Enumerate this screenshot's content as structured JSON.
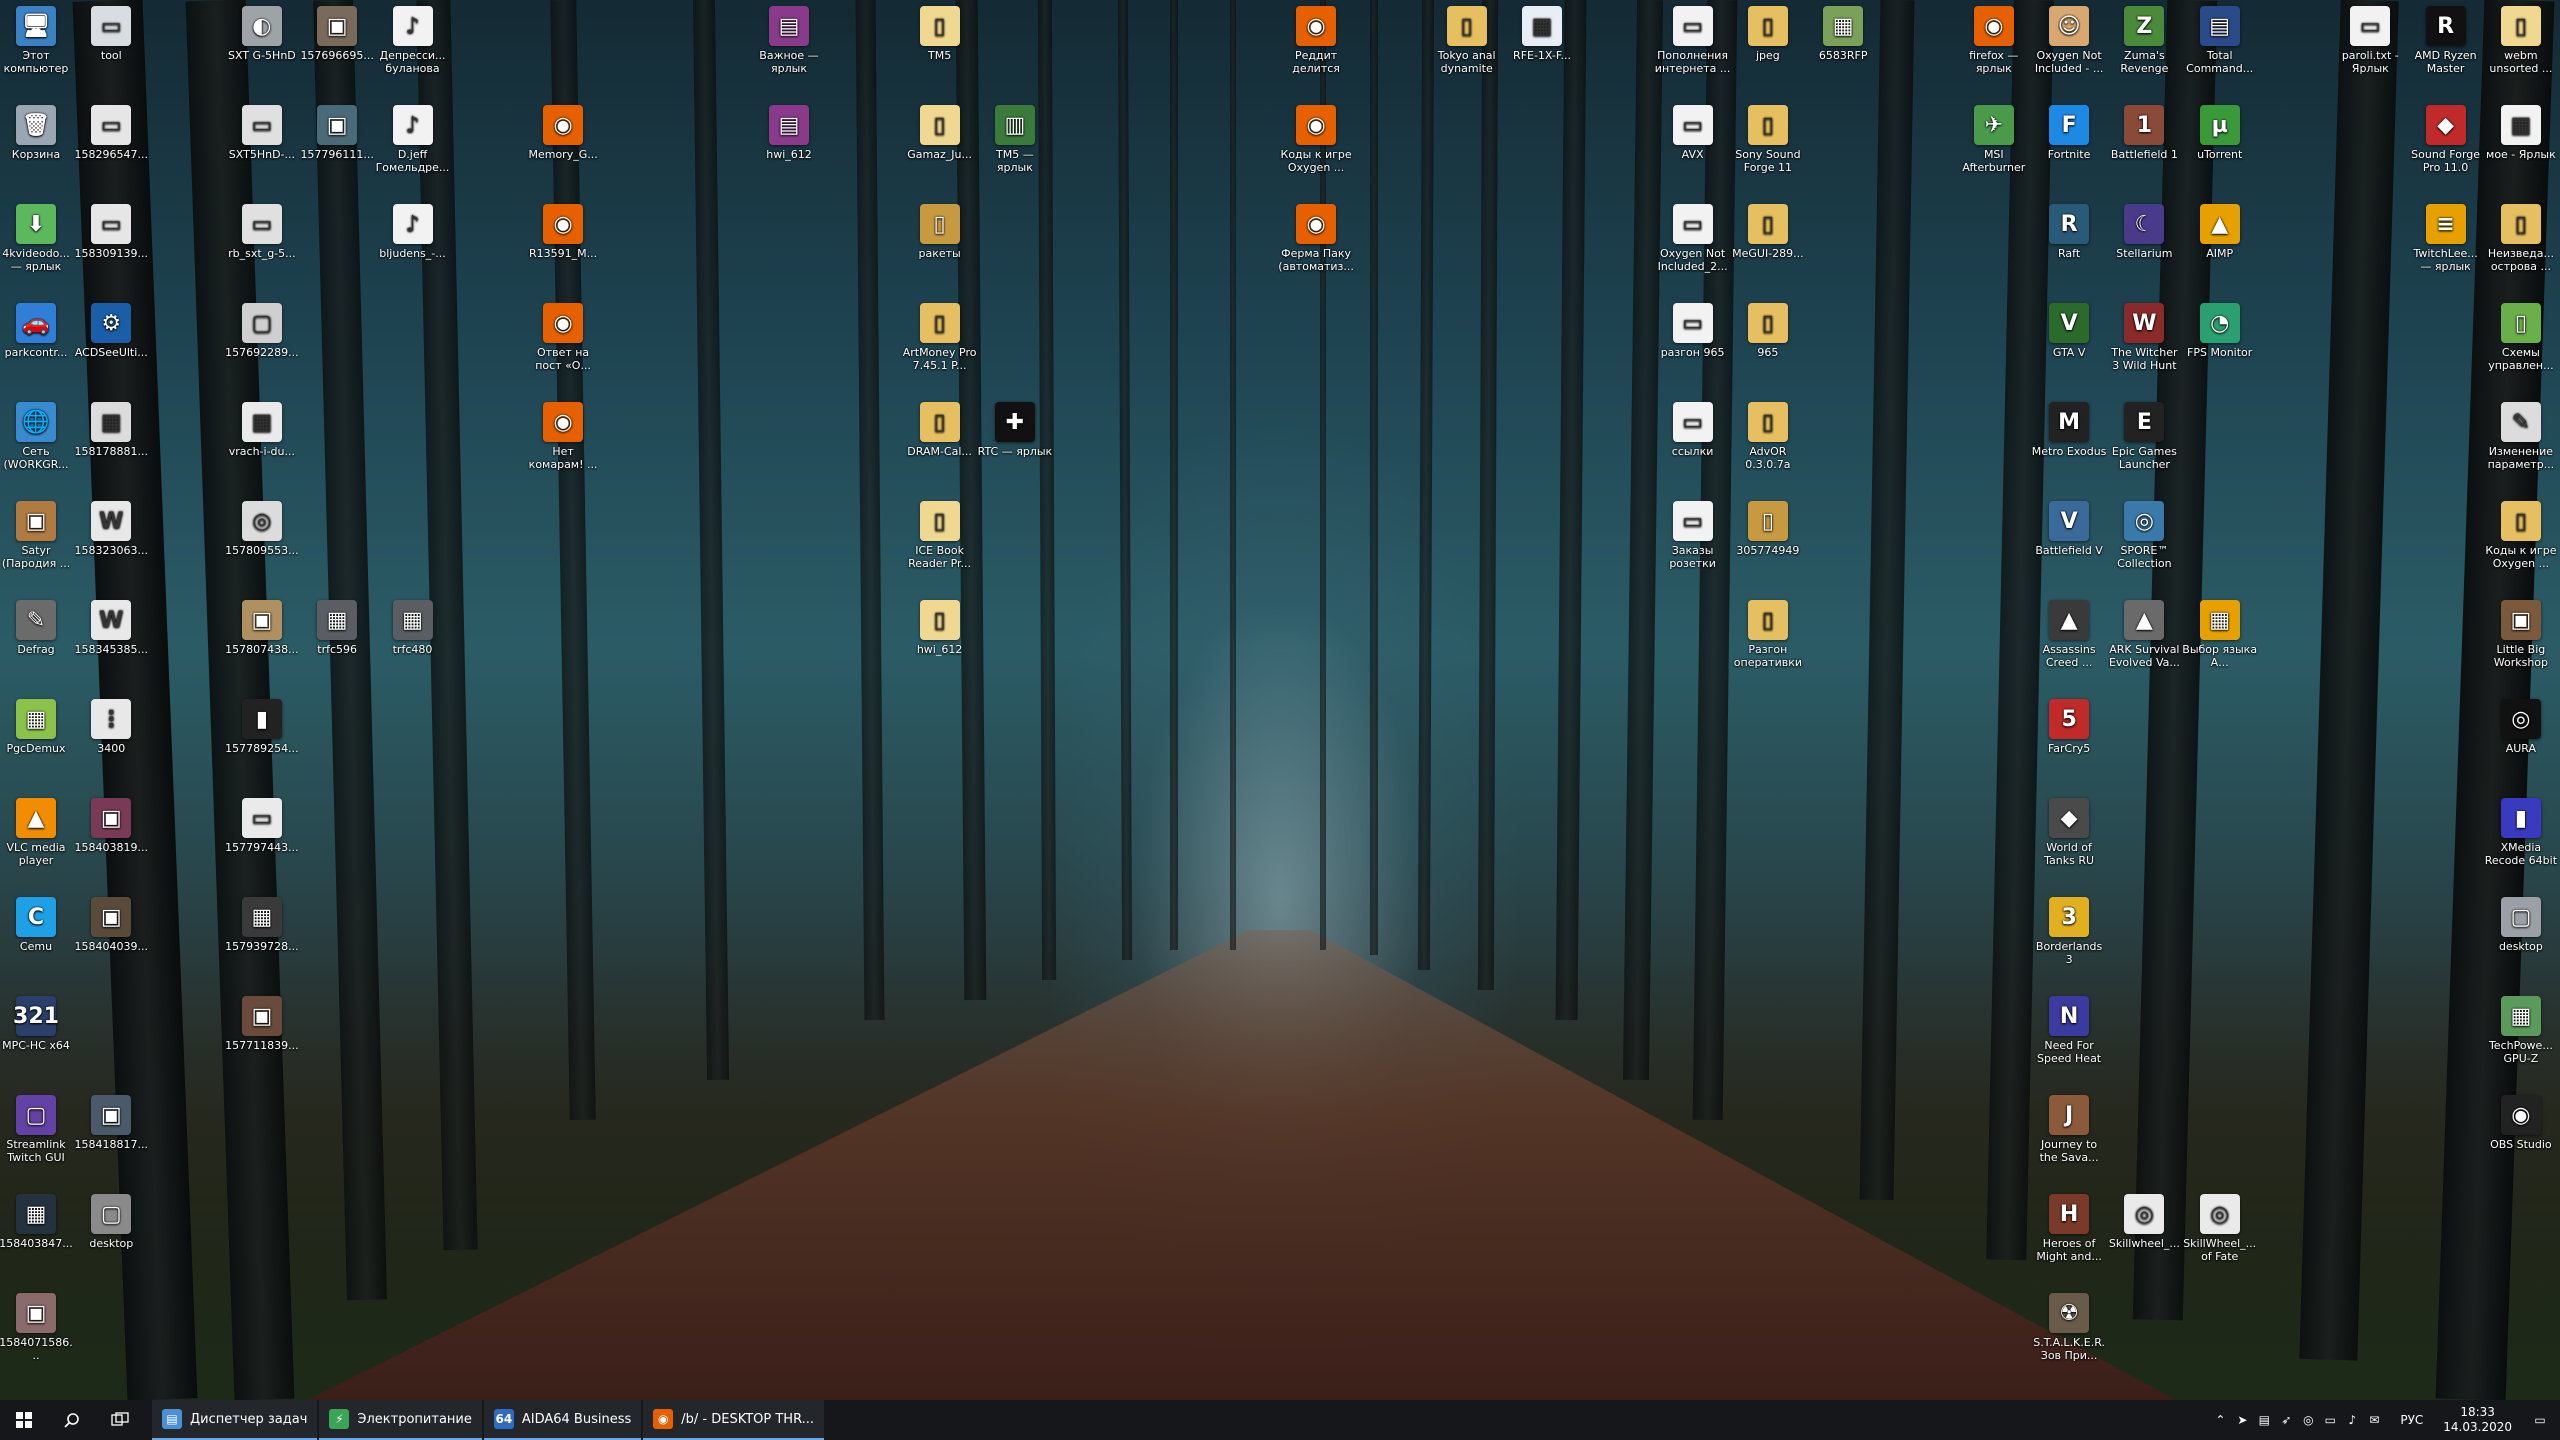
{
  "taskbar": {
    "start_icon": "windows-logo-icon",
    "search_icon": "search-icon",
    "taskview_icon": "task-view-icon",
    "apps": [
      {
        "label": "Диспетчер задач",
        "color": "#4a90d9",
        "glyph": "▤"
      },
      {
        "label": "Электропитание",
        "color": "#3aa655",
        "glyph": "⚡"
      },
      {
        "label": "AIDA64 Business",
        "color": "#2d6cc0",
        "glyph": "64"
      },
      {
        "label": "/b/ - DESKTOP THR...",
        "color": "#e66000",
        "glyph": "◉"
      }
    ],
    "tray": {
      "language": "РУС",
      "time": "18:33",
      "date": "14.03.2020",
      "icons": [
        "chevron-up-icon",
        "telegram-icon",
        "network-drive-icon",
        "cursor-icon",
        "steam-icon",
        "display-icon",
        "volume-icon",
        "notification-icon"
      ]
    }
  },
  "icons": [
    {
      "label": "Этот компьютер",
      "color": "#3b82c4",
      "glyph": "🖥",
      "col": 0,
      "row": 0
    },
    {
      "label": "Корзина",
      "color": "#9aa7b3",
      "glyph": "🗑",
      "col": 0,
      "row": 1
    },
    {
      "label": "4kvideodo... — ярлык",
      "color": "#5cb85c",
      "glyph": "⬇",
      "col": 0,
      "row": 2
    },
    {
      "label": "parkcontr...",
      "color": "#2f7fd8",
      "glyph": "🚗",
      "col": 0,
      "row": 3
    },
    {
      "label": "Сеть (WORKGR...",
      "color": "#3a8ad0",
      "glyph": "🌐",
      "col": 0,
      "row": 4
    },
    {
      "label": "Satyr (Пародия ...",
      "color": "#b07a40",
      "glyph": "▣",
      "col": 0,
      "row": 5
    },
    {
      "label": "Defrag",
      "color": "#6b6b6b",
      "glyph": "✎",
      "col": 0,
      "row": 6
    },
    {
      "label": "PgcDemux",
      "color": "#8bc34a",
      "glyph": "▦",
      "col": 0,
      "row": 7
    },
    {
      "label": "VLC media player",
      "color": "#f28c00",
      "glyph": "▲",
      "col": 0,
      "row": 8
    },
    {
      "label": "Cemu",
      "color": "#1ea0e6",
      "glyph": "C",
      "col": 0,
      "row": 9
    },
    {
      "label": "MPC-HC x64",
      "color": "#2a3f6a",
      "glyph": "321",
      "col": 0,
      "row": 10
    },
    {
      "label": "Streamlink Twitch GUI",
      "color": "#6441a5",
      "glyph": "▢",
      "col": 0,
      "row": 11
    },
    {
      "label": "158403847...",
      "color": "#24323f",
      "glyph": "▦",
      "col": 0,
      "row": 12
    },
    {
      "label": "1584071586...",
      "color": "#8a6a6a",
      "glyph": "▣",
      "col": 0,
      "row": 13
    },
    {
      "label": "tool",
      "color": "#d8dde2",
      "glyph": "▭",
      "col": 1,
      "row": 0
    },
    {
      "label": "158296547...",
      "color": "#e6e6e6",
      "glyph": "▭",
      "col": 1,
      "row": 1
    },
    {
      "label": "158309139...",
      "color": "#e6e6e6",
      "glyph": "▭",
      "col": 1,
      "row": 2
    },
    {
      "label": "ACDSeeUlti...",
      "color": "#1b5ea8",
      "glyph": "⚙",
      "col": 1,
      "row": 3
    },
    {
      "label": "158178881...",
      "color": "#dcdcdc",
      "glyph": "▦",
      "col": 1,
      "row": 4
    },
    {
      "label": "158323063...",
      "color": "#e8e8e8",
      "glyph": "W",
      "col": 1,
      "row": 5
    },
    {
      "label": "158345385...",
      "color": "#e8e8e8",
      "glyph": "W",
      "col": 1,
      "row": 6
    },
    {
      "label": "3400",
      "color": "#e8e8e8",
      "glyph": "⋮",
      "col": 1,
      "row": 7
    },
    {
      "label": "158403819...",
      "color": "#7a3a55",
      "glyph": "▣",
      "col": 1,
      "row": 8
    },
    {
      "label": "158404039...",
      "color": "#5a4a3a",
      "glyph": "▣",
      "col": 1,
      "row": 9
    },
    {
      "label": "158418817...",
      "color": "#4a5a6a",
      "glyph": "▣",
      "col": 1,
      "row": 11
    },
    {
      "label": "desktop",
      "color": "#8a8a8a",
      "glyph": "▢",
      "col": 1,
      "row": 12
    },
    {
      "label": "SXT G-5HnD",
      "color": "#9ea3a8",
      "glyph": "◐",
      "col": 3,
      "row": 0
    },
    {
      "label": "SXT5HnD-...",
      "color": "#e0e0e0",
      "glyph": "▭",
      "col": 3,
      "row": 1
    },
    {
      "label": "rb_sxt_g-5...",
      "color": "#e0e0e0",
      "glyph": "▭",
      "col": 3,
      "row": 2
    },
    {
      "label": "157692289...",
      "color": "#cfcfcf",
      "glyph": "▢",
      "col": 3,
      "row": 3
    },
    {
      "label": "vrach-i-du...",
      "color": "#eaeaea",
      "glyph": "▦",
      "col": 3,
      "row": 4
    },
    {
      "label": "157809553...",
      "color": "#dcdcdc",
      "glyph": "◎",
      "col": 3,
      "row": 5
    },
    {
      "label": "157807438...",
      "color": "#b09060",
      "glyph": "▣",
      "col": 3,
      "row": 6
    },
    {
      "label": "157789254...",
      "color": "#222",
      "glyph": "▮",
      "col": 3,
      "row": 7
    },
    {
      "label": "157797443...",
      "color": "#eaeaea",
      "glyph": "▭",
      "col": 3,
      "row": 8
    },
    {
      "label": "157939728...",
      "color": "#3a3a3a",
      "glyph": "▦",
      "col": 3,
      "row": 9
    },
    {
      "label": "157711839...",
      "color": "#6a4a3a",
      "glyph": "▣",
      "col": 3,
      "row": 10
    },
    {
      "label": "157696695...",
      "color": "#7a6a5a",
      "glyph": "▣",
      "col": 4,
      "row": 0
    },
    {
      "label": "157796111...",
      "color": "#4a6a7a",
      "glyph": "▣",
      "col": 4,
      "row": 1
    },
    {
      "label": "trfc596",
      "color": "#5a5e62",
      "glyph": "▦",
      "col": 4,
      "row": 6
    },
    {
      "label": "Депресси... буланова",
      "color": "#f2f2f2",
      "glyph": "♪",
      "col": 5,
      "row": 0
    },
    {
      "label": "D.jeff Гомельдре...",
      "color": "#f2f2f2",
      "glyph": "♪",
      "col": 5,
      "row": 1
    },
    {
      "label": "bljudens_-...",
      "color": "#f2f2f2",
      "glyph": "♪",
      "col": 5,
      "row": 2
    },
    {
      "label": "trfc480",
      "color": "#5a5e62",
      "glyph": "▦",
      "col": 5,
      "row": 6
    },
    {
      "label": "Memory_G...",
      "color": "#e66000",
      "glyph": "◉",
      "col": 7,
      "row": 1
    },
    {
      "label": "R13591_M...",
      "color": "#e66000",
      "glyph": "◉",
      "col": 7,
      "row": 2
    },
    {
      "label": "Ответ на пост «О...",
      "color": "#e66000",
      "glyph": "◉",
      "col": 7,
      "row": 3
    },
    {
      "label": "Нет комарам! ...",
      "color": "#e66000",
      "glyph": "◉",
      "col": 7,
      "row": 4
    },
    {
      "label": "Важное — ярлык",
      "color": "#8a3a8a",
      "glyph": "▤",
      "col": 10,
      "row": 0
    },
    {
      "label": "hwi_612",
      "color": "#8a3a8a",
      "glyph": "▤",
      "col": 10,
      "row": 1
    },
    {
      "label": "TM5",
      "color": "#f0d890",
      "glyph": "▯",
      "col": 12,
      "row": 0
    },
    {
      "label": "Gamaz_Ju...",
      "color": "#f0d890",
      "glyph": "▯",
      "col": 12,
      "row": 1
    },
    {
      "label": "ракеты",
      "color": "#c89a40",
      "glyph": "▯",
      "col": 12,
      "row": 2
    },
    {
      "label": "ArtMoney Pro 7.45.1 P...",
      "color": "#e6c060",
      "glyph": "▯",
      "col": 12,
      "row": 3
    },
    {
      "label": "DRAM-Cal...",
      "color": "#e6c060",
      "glyph": "▯",
      "col": 12,
      "row": 4
    },
    {
      "label": "ICE Book Reader Pr...",
      "color": "#f0d890",
      "glyph": "▯",
      "col": 12,
      "row": 5
    },
    {
      "label": "hwi_612",
      "color": "#f0d890",
      "glyph": "▯",
      "col": 12,
      "row": 6
    },
    {
      "label": "TM5 — ярлык",
      "color": "#3a7a3a",
      "glyph": "▥",
      "col": 13,
      "row": 1
    },
    {
      "label": "RTC — ярлык",
      "color": "#111",
      "glyph": "✚",
      "col": 13,
      "row": 4
    },
    {
      "label": "Реддит делится эф...",
      "color": "#e66000",
      "glyph": "◉",
      "col": 17,
      "row": 0
    },
    {
      "label": "Коды к игре Oxygen ...",
      "color": "#e66000",
      "glyph": "◉",
      "col": 17,
      "row": 1
    },
    {
      "label": "Ферма Паку (автоматиз...",
      "color": "#e66000",
      "glyph": "◉",
      "col": 17,
      "row": 2
    },
    {
      "label": "Tokyo anal dynamite",
      "color": "#e6c060",
      "glyph": "▯",
      "col": 19,
      "row": 0
    },
    {
      "label": "RFE-1X-F...",
      "color": "#e8eef5",
      "glyph": "▦",
      "col": 20,
      "row": 0
    },
    {
      "label": "Пополнения интернета ...",
      "color": "#f2f2f2",
      "glyph": "▭",
      "col": 22,
      "row": 0
    },
    {
      "label": "AVX",
      "color": "#f2f2f2",
      "glyph": "▭",
      "col": 22,
      "row": 1
    },
    {
      "label": "Oxygen Not Included_2...",
      "color": "#f2f2f2",
      "glyph": "▭",
      "col": 22,
      "row": 2
    },
    {
      "label": "разгон 965",
      "color": "#f2f2f2",
      "glyph": "▭",
      "col": 22,
      "row": 3
    },
    {
      "label": "ссылки",
      "color": "#f2f2f2",
      "glyph": "▭",
      "col": 22,
      "row": 4
    },
    {
      "label": "Заказы розетки",
      "color": "#f2f2f2",
      "glyph": "▭",
      "col": 22,
      "row": 5
    },
    {
      "label": "jpeg",
      "color": "#e6c060",
      "glyph": "▯",
      "col": 23,
      "row": 0
    },
    {
      "label": "Sony Sound Forge 11",
      "color": "#e6c060",
      "glyph": "▯",
      "col": 23,
      "row": 1
    },
    {
      "label": "MeGUI-289...",
      "color": "#e6c060",
      "glyph": "▯",
      "col": 23,
      "row": 2
    },
    {
      "label": "965",
      "color": "#e6c060",
      "glyph": "▯",
      "col": 23,
      "row": 3
    },
    {
      "label": "AdvOR 0.3.0.7a",
      "color": "#e6c060",
      "glyph": "▯",
      "col": 23,
      "row": 4
    },
    {
      "label": "305774949",
      "color": "#c89a40",
      "glyph": "▯",
      "col": 23,
      "row": 5
    },
    {
      "label": "Разгон оперативки",
      "color": "#e6c060",
      "glyph": "▯",
      "col": 23,
      "row": 6
    },
    {
      "label": "6583RFP",
      "color": "#7aa05a",
      "glyph": "▦",
      "col": 24,
      "row": 0
    },
    {
      "label": "firefox — ярлык",
      "color": "#e66000",
      "glyph": "◉",
      "col": 26,
      "row": 0
    },
    {
      "label": "MSI Afterburner",
      "color": "#4a9a4a",
      "glyph": "✈",
      "col": 26,
      "row": 1
    },
    {
      "label": "Oxygen Not Included - ...",
      "color": "#d8a870",
      "glyph": "☺",
      "col": 27,
      "row": 0
    },
    {
      "label": "Fortnite",
      "color": "#1e88e5",
      "glyph": "F",
      "col": 27,
      "row": 1
    },
    {
      "label": "Raft",
      "color": "#2a5a7a",
      "glyph": "R",
      "col": 27,
      "row": 2
    },
    {
      "label": "GTA V",
      "color": "#2a6a2a",
      "glyph": "V",
      "col": 27,
      "row": 3
    },
    {
      "label": "Metro Exodus",
      "color": "#222",
      "glyph": "M",
      "col": 27,
      "row": 4
    },
    {
      "label": "Battlefield V",
      "color": "#3a6a9a",
      "glyph": "V",
      "col": 27,
      "row": 5
    },
    {
      "label": "Assassins Creed ...",
      "color": "#3a3a3a",
      "glyph": "▲",
      "col": 27,
      "row": 6
    },
    {
      "label": "FarCry5",
      "color": "#c02a2a",
      "glyph": "5",
      "col": 27,
      "row": 7
    },
    {
      "label": "World of Tanks RU",
      "color": "#4a4a4a",
      "glyph": "◆",
      "col": 27,
      "row": 8
    },
    {
      "label": "Borderlands 3",
      "color": "#e0b020",
      "glyph": "3",
      "col": 27,
      "row": 9
    },
    {
      "label": "Need For Speed Heat",
      "color": "#3a3aa0",
      "glyph": "N",
      "col": 27,
      "row": 10
    },
    {
      "label": "Journey to the Sava...",
      "color": "#8a5a3a",
      "glyph": "J",
      "col": 27,
      "row": 11
    },
    {
      "label": "Heroes of Might and...",
      "color": "#7a3a2a",
      "glyph": "H",
      "col": 27,
      "row": 12
    },
    {
      "label": "S.T.A.L.K.E.R. Зов При...",
      "color": "#6a5a4a",
      "glyph": "☢",
      "col": 27,
      "row": 13
    },
    {
      "label": "Zuma's Revenge",
      "color": "#4a8a3a",
      "glyph": "Z",
      "col": 28,
      "row": 0
    },
    {
      "label": "Battlefield 1",
      "color": "#8a4a3a",
      "glyph": "1",
      "col": 28,
      "row": 1
    },
    {
      "label": "Stellarium",
      "color": "#4a3a8a",
      "glyph": "☾",
      "col": 28,
      "row": 2
    },
    {
      "label": "The Witcher 3 Wild Hunt",
      "color": "#8a2a2a",
      "glyph": "W",
      "col": 28,
      "row": 3
    },
    {
      "label": "Epic Games Launcher",
      "color": "#222",
      "glyph": "E",
      "col": 28,
      "row": 4
    },
    {
      "label": "SPORE™ Collection",
      "color": "#3a7aaa",
      "glyph": "◎",
      "col": 28,
      "row": 5
    },
    {
      "label": "ARK Survival Evolved Va...",
      "color": "#6a6a6a",
      "glyph": "▲",
      "col": 28,
      "row": 6
    },
    {
      "label": "Skillwheel_...",
      "color": "#eaeaea",
      "glyph": "◎",
      "col": 28,
      "row": 12
    },
    {
      "label": "Total Command...",
      "color": "#2a4a8a",
      "glyph": "▤",
      "col": 29,
      "row": 0
    },
    {
      "label": "uTorrent",
      "color": "#3a9a3a",
      "glyph": "µ",
      "col": 29,
      "row": 1
    },
    {
      "label": "AIMP",
      "color": "#e6a000",
      "glyph": "▲",
      "col": 29,
      "row": 2
    },
    {
      "label": "FPS Monitor",
      "color": "#2aa070",
      "glyph": "◔",
      "col": 29,
      "row": 3
    },
    {
      "label": "Выбор языка А...",
      "color": "#e6a000",
      "glyph": "▦",
      "col": 29,
      "row": 6
    },
    {
      "label": "SkillWheel_... of Fate",
      "color": "#eaeaea",
      "glyph": "◎",
      "col": 29,
      "row": 12
    },
    {
      "label": "paroli.txt - Ярлык",
      "color": "#f2f2f2",
      "glyph": "▭",
      "col": 31,
      "row": 0
    },
    {
      "label": "AMD Ryzen Master",
      "color": "#111",
      "glyph": "R",
      "col": 32,
      "row": 0
    },
    {
      "label": "Sound Forge Pro 11.0",
      "color": "#c02a2a",
      "glyph": "◆",
      "col": 32,
      "row": 1
    },
    {
      "label": "TwitchLee... — ярлык",
      "color": "#e6a000",
      "glyph": "≡",
      "col": 32,
      "row": 2
    },
    {
      "label": "webm unsorted ...",
      "color": "#f0d890",
      "glyph": "▯",
      "col": 33,
      "row": 0
    },
    {
      "label": "мое - Ярлык",
      "color": "#f2f2f2",
      "glyph": "▦",
      "col": 33,
      "row": 1
    },
    {
      "label": "Неизведа... острова ...",
      "color": "#e6c060",
      "glyph": "▯",
      "col": 33,
      "row": 2
    },
    {
      "label": "Схемы управлен...",
      "color": "#6ab04a",
      "glyph": "▯",
      "col": 33,
      "row": 3
    },
    {
      "label": "Изменение параметр...",
      "color": "#dcdcdc",
      "glyph": "✎",
      "col": 33,
      "row": 4
    },
    {
      "label": "Коды к игре Oxygen ...",
      "color": "#e6c060",
      "glyph": "▯",
      "col": 33,
      "row": 5
    },
    {
      "label": "Little Big Workshop",
      "color": "#7a5a3a",
      "glyph": "▣",
      "col": 33,
      "row": 6
    },
    {
      "label": "AURA",
      "color": "#111",
      "glyph": "◎",
      "col": 33,
      "row": 7
    },
    {
      "label": "XMedia Recode 64bit",
      "color": "#3a3ac0",
      "glyph": "▮",
      "col": 33,
      "row": 8
    },
    {
      "label": "desktop",
      "color": "#9aa0a5",
      "glyph": "▢",
      "col": 33,
      "row": 9
    },
    {
      "label": "TechPowe... GPU-Z",
      "color": "#5a9a5a",
      "glyph": "▦",
      "col": 33,
      "row": 10
    },
    {
      "label": "OBS Studio",
      "color": "#222",
      "glyph": "◉",
      "col": 33,
      "row": 11
    }
  ]
}
